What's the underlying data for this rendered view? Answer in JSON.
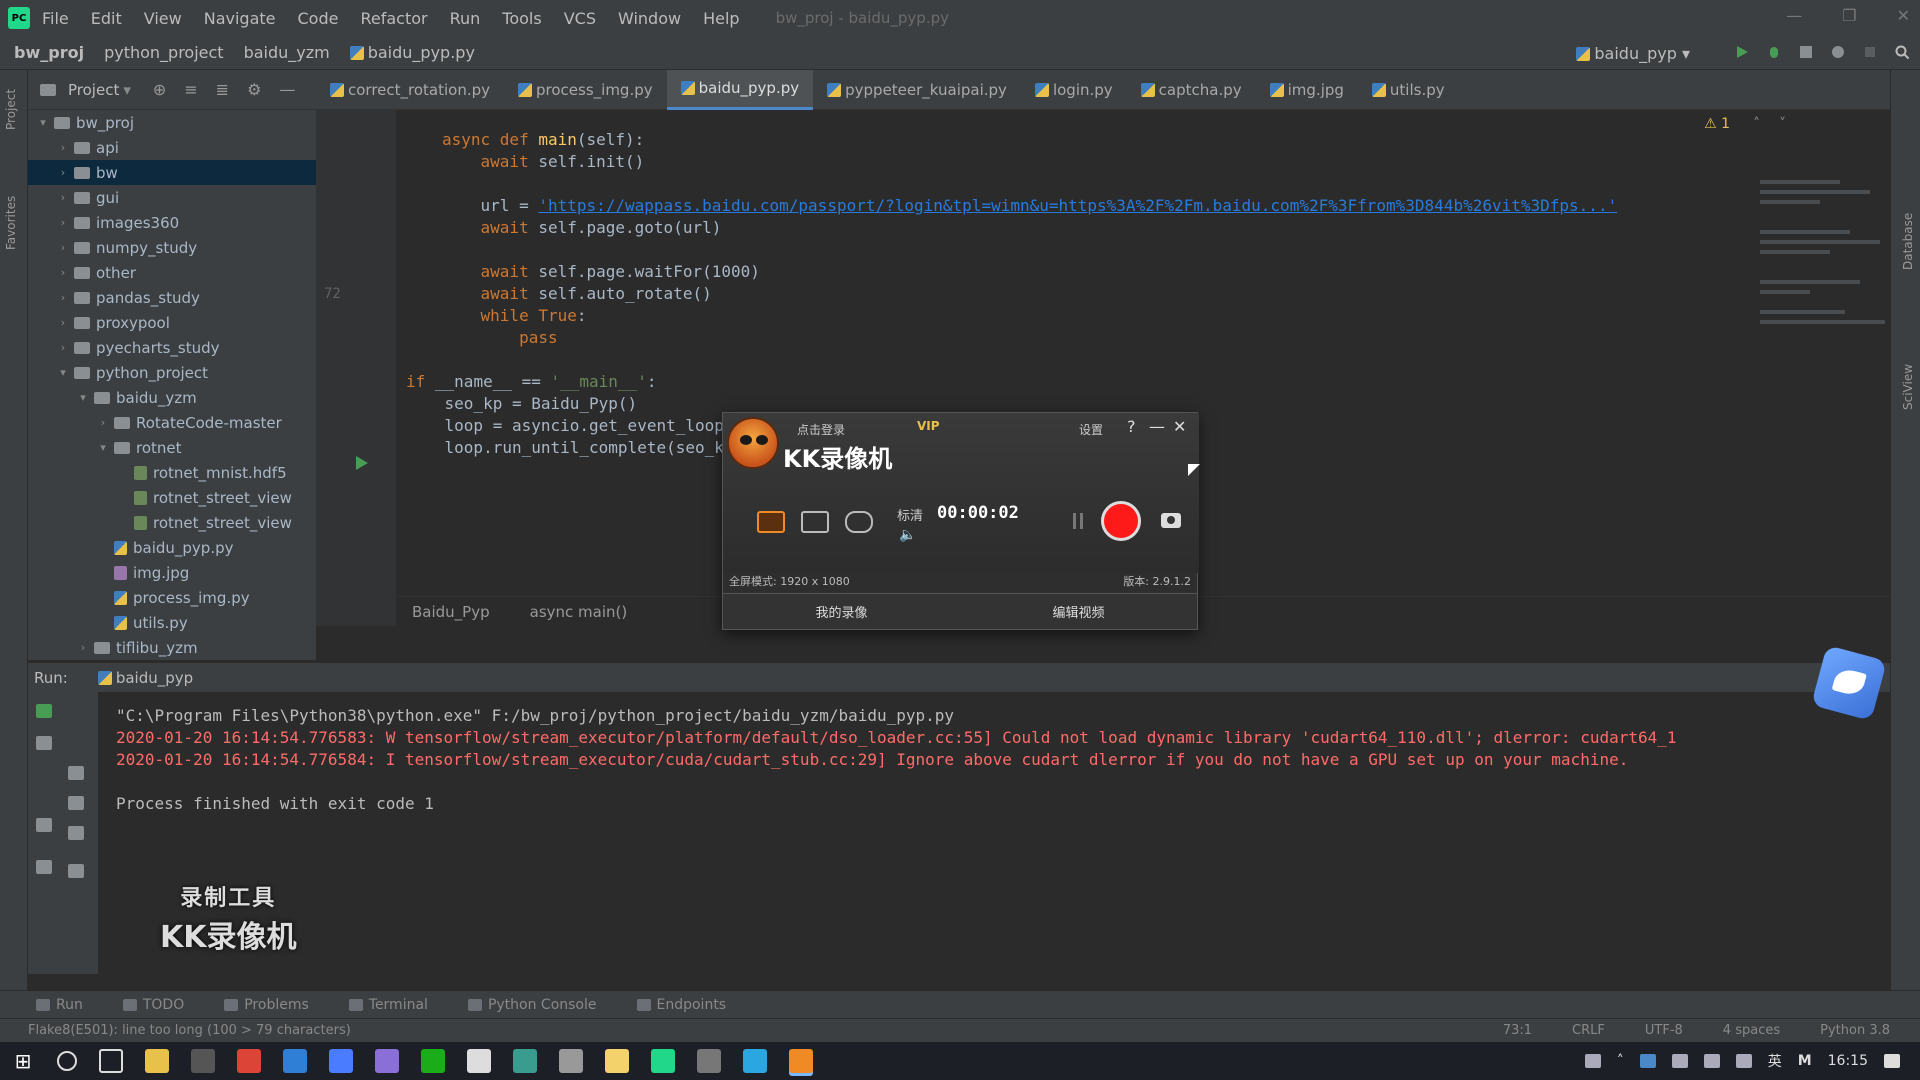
{
  "menubar": {
    "items": [
      "File",
      "Edit",
      "View",
      "Navigate",
      "Code",
      "Refactor",
      "Run",
      "Tools",
      "VCS",
      "Window",
      "Help"
    ],
    "window_title": "bw_proj - baidu_pyp.py"
  },
  "navbar": {
    "crumbs": [
      "bw_proj",
      "python_project",
      "baidu_yzm",
      "baidu_pyp.py"
    ],
    "run_config": "baidu_pyp"
  },
  "project_panel": {
    "title": "Project",
    "tree": [
      {
        "label": "bw_proj",
        "depth": 0,
        "type": "folder",
        "expanded": true
      },
      {
        "label": "api",
        "depth": 1,
        "type": "folder"
      },
      {
        "label": "bw",
        "depth": 1,
        "type": "folder",
        "selected": true
      },
      {
        "label": "gui",
        "depth": 1,
        "type": "folder"
      },
      {
        "label": "images360",
        "depth": 1,
        "type": "folder"
      },
      {
        "label": "numpy_study",
        "depth": 1,
        "type": "folder"
      },
      {
        "label": "other",
        "depth": 1,
        "type": "folder"
      },
      {
        "label": "pandas_study",
        "depth": 1,
        "type": "folder"
      },
      {
        "label": "proxypool",
        "depth": 1,
        "type": "folder"
      },
      {
        "label": "pyecharts_study",
        "depth": 1,
        "type": "folder"
      },
      {
        "label": "python_project",
        "depth": 1,
        "type": "folder",
        "expanded": true
      },
      {
        "label": "baidu_yzm",
        "depth": 2,
        "type": "folder",
        "expanded": true
      },
      {
        "label": "RotateCode-master",
        "depth": 3,
        "type": "folder"
      },
      {
        "label": "rotnet",
        "depth": 3,
        "type": "folder",
        "expanded": true
      },
      {
        "label": "rotnet_mnist.hdf5",
        "depth": 4,
        "type": "h5"
      },
      {
        "label": "rotnet_street_view",
        "depth": 4,
        "type": "h5"
      },
      {
        "label": "rotnet_street_view",
        "depth": 4,
        "type": "h5"
      },
      {
        "label": "baidu_pyp.py",
        "depth": 3,
        "type": "py"
      },
      {
        "label": "img.jpg",
        "depth": 3,
        "type": "img"
      },
      {
        "label": "process_img.py",
        "depth": 3,
        "type": "py"
      },
      {
        "label": "utils.py",
        "depth": 3,
        "type": "py"
      },
      {
        "label": "tiflibu_yzm",
        "depth": 2,
        "type": "folder"
      }
    ]
  },
  "tabs": [
    {
      "label": "correct_rotation.py",
      "active": false
    },
    {
      "label": "process_img.py",
      "active": false
    },
    {
      "label": "baidu_pyp.py",
      "active": true
    },
    {
      "label": "pyppeteer_kuaipai.py",
      "active": false
    },
    {
      "label": "login.py",
      "active": false
    },
    {
      "label": "captcha.py",
      "active": false
    },
    {
      "label": "img.jpg",
      "active": false
    },
    {
      "label": "utils.py",
      "active": false
    }
  ],
  "editor": {
    "warning_count": "1",
    "line_number": "72",
    "code": [
      {
        "parts": [
          [
            "kw",
            "async def "
          ],
          [
            "fn",
            "main"
          ],
          [
            "n",
            "(self):"
          ]
        ]
      },
      {
        "parts": [
          [
            "n",
            "    "
          ],
          [
            "kw",
            "await "
          ],
          [
            "n",
            "self.init()"
          ]
        ]
      },
      {
        "parts": [
          [
            "n",
            ""
          ]
        ]
      },
      {
        "parts": [
          [
            "n",
            "    url = "
          ],
          [
            "url",
            "'https://wappass.baidu.com/passport/?login&tpl=wimn&u=https%3A%2F%2Fm.baidu.com%2F%3Ffrom%3D844b%26vit%3Dfps...'"
          ]
        ]
      },
      {
        "parts": [
          [
            "n",
            "    "
          ],
          [
            "kw",
            "await "
          ],
          [
            "n",
            "self.page.goto(url)"
          ]
        ]
      },
      {
        "parts": [
          [
            "n",
            ""
          ]
        ]
      },
      {
        "parts": [
          [
            "n",
            "    "
          ],
          [
            "kw",
            "await "
          ],
          [
            "n",
            "self.page.waitFor(1000)"
          ]
        ]
      },
      {
        "parts": [
          [
            "n",
            "    "
          ],
          [
            "kw",
            "await "
          ],
          [
            "n",
            "self.auto_rotate()"
          ]
        ]
      },
      {
        "parts": [
          [
            "n",
            "    "
          ],
          [
            "kw",
            "while True"
          ],
          [
            "n",
            ":"
          ]
        ]
      },
      {
        "parts": [
          [
            "n",
            "        "
          ],
          [
            "kw",
            "pass"
          ]
        ]
      },
      {
        "parts": [
          [
            "n",
            ""
          ]
        ]
      },
      {
        "parts": [
          [
            "kw",
            "if "
          ],
          [
            "n",
            "__name__ == "
          ],
          [
            "str",
            "'__main__'"
          ],
          [
            "n",
            ":"
          ]
        ]
      },
      {
        "parts": [
          [
            "n",
            "    seo_kp = Baidu_Pyp()"
          ]
        ]
      },
      {
        "parts": [
          [
            "n",
            "    loop = asyncio.get_event_loop()"
          ]
        ]
      },
      {
        "parts": [
          [
            "n",
            "    loop.run_until_complete(seo_kp.main())"
          ]
        ]
      }
    ],
    "breadcrumb": [
      "Baidu_Pyp",
      "async main()"
    ]
  },
  "run_panel": {
    "label": "Run:",
    "config": "baidu_pyp",
    "console": [
      {
        "kind": "normal",
        "text": "\"C:\\Program Files\\Python38\\python.exe\" F:/bw_proj/python_project/baidu_yzm/baidu_pyp.py"
      },
      {
        "kind": "err",
        "text": "2020-01-20 16:14:54.776583: W tensorflow/stream_executor/platform/default/dso_loader.cc:55] Could not load dynamic library 'cudart64_110.dll'; dlerror: cudart64_1"
      },
      {
        "kind": "err",
        "text": "2020-01-20 16:14:54.776584: I tensorflow/stream_executor/cuda/cudart_stub.cc:29] Ignore above cudart dlerror if you do not have a GPU set up on your machine."
      },
      {
        "kind": "normal",
        "text": ""
      },
      {
        "kind": "normal",
        "text": "Process finished with exit code 1"
      }
    ]
  },
  "watermark": {
    "line1": "录制工具",
    "line2": "KK录像机"
  },
  "toolwindows": [
    "Run",
    "TODO",
    "Problems",
    "Terminal",
    "Python Console",
    "Endpoints"
  ],
  "statusbar": {
    "left": "Flake8(E501): line too long (100 > 79 characters)",
    "position": "73:1",
    "line_sep": "CRLF",
    "encoding": "UTF-8",
    "indent": "4 spaces",
    "interpreter": "Python 3.8"
  },
  "kk": {
    "brand": "KK录像机",
    "login": "点击登录",
    "vip": "VIP",
    "settings": "设置",
    "help": "?",
    "minimize": "—",
    "close": "✕",
    "quality": "标清",
    "timer": "00:00:02",
    "mode_text": "全屏模式: 1920 x 1080",
    "version": "版本: 2.9.1.2",
    "btn_left": "我的录像",
    "btn_right": "编辑视频"
  },
  "taskbar": {
    "time": "16:15",
    "lang": "英"
  },
  "colors": {
    "accent": "#4a88c7",
    "error": "#ff6b68",
    "keyword": "#cc7832",
    "record": "#ff1a1a"
  }
}
